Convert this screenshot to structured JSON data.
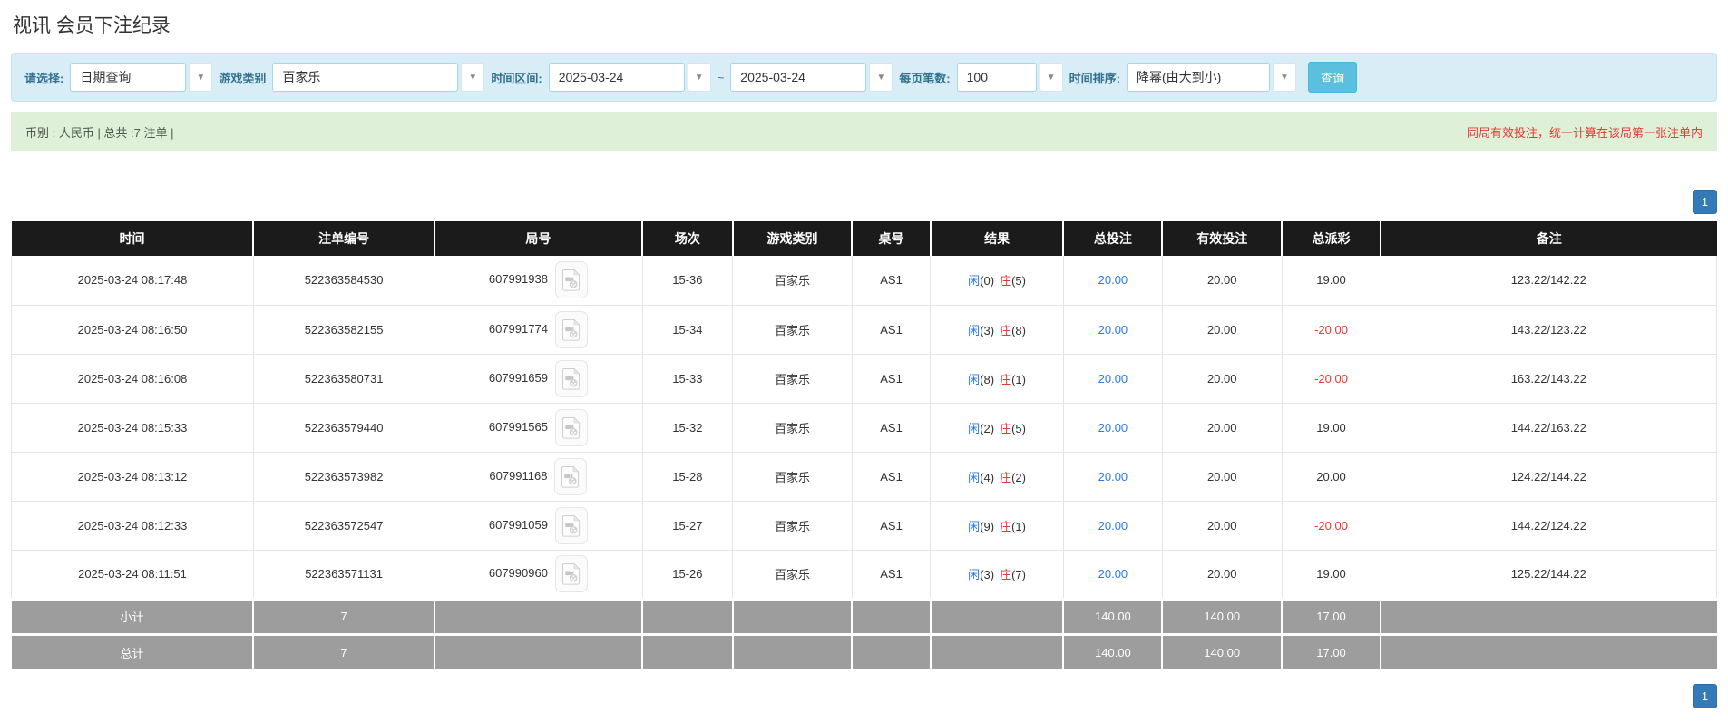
{
  "header": {
    "title": "视讯 会员下注纪录"
  },
  "icons": {
    "chevron_down": "▼"
  },
  "filters": {
    "select_label": "请选择:",
    "select_value": "日期查询",
    "game_label": "游戏类别",
    "game_value": "百家乐",
    "range_label": "时间区间:",
    "date_from": "2025-03-24",
    "tilde": "~",
    "date_to": "2025-03-24",
    "page_size_label": "每页笔数:",
    "page_size_value": "100",
    "sort_label": "时间排序:",
    "sort_value": "降幂(由大到小)",
    "query_button": "查询"
  },
  "summary": {
    "left": "币别 : 人民币 | 总共 :7 注单 |",
    "note": "同局有效投注，统一计算在该局第一张注单内"
  },
  "pagination": {
    "page": "1"
  },
  "table": {
    "headers": [
      "时间",
      "注单编号",
      "局号",
      "场次",
      "游戏类别",
      "桌号",
      "结果",
      "总投注",
      "有效投注",
      "总派彩",
      "备注"
    ],
    "rows": [
      {
        "time": "2025-03-24 08:17:48",
        "bet_no": "522363584530",
        "round_no": "607991938",
        "session": "15-36",
        "game": "百家乐",
        "table": "AS1",
        "result": {
          "player": "闲",
          "player_n": "(0)",
          "banker": "庄",
          "banker_n": "(5)"
        },
        "total_bet": "20.00",
        "valid_bet": "20.00",
        "payout": "19.00",
        "payout_class": "pos",
        "remark": "123.22/142.22"
      },
      {
        "time": "2025-03-24 08:16:50",
        "bet_no": "522363582155",
        "round_no": "607991774",
        "session": "15-34",
        "game": "百家乐",
        "table": "AS1",
        "result": {
          "player": "闲",
          "player_n": "(3)",
          "banker": "庄",
          "banker_n": "(8)"
        },
        "total_bet": "20.00",
        "valid_bet": "20.00",
        "payout": "-20.00",
        "payout_class": "neg",
        "remark": "143.22/123.22"
      },
      {
        "time": "2025-03-24 08:16:08",
        "bet_no": "522363580731",
        "round_no": "607991659",
        "session": "15-33",
        "game": "百家乐",
        "table": "AS1",
        "result": {
          "player": "闲",
          "player_n": "(8)",
          "banker": "庄",
          "banker_n": "(1)"
        },
        "total_bet": "20.00",
        "valid_bet": "20.00",
        "payout": "-20.00",
        "payout_class": "neg",
        "remark": "163.22/143.22"
      },
      {
        "time": "2025-03-24 08:15:33",
        "bet_no": "522363579440",
        "round_no": "607991565",
        "session": "15-32",
        "game": "百家乐",
        "table": "AS1",
        "result": {
          "player": "闲",
          "player_n": "(2)",
          "banker": "庄",
          "banker_n": "(5)"
        },
        "total_bet": "20.00",
        "valid_bet": "20.00",
        "payout": "19.00",
        "payout_class": "pos",
        "remark": "144.22/163.22"
      },
      {
        "time": "2025-03-24 08:13:12",
        "bet_no": "522363573982",
        "round_no": "607991168",
        "session": "15-28",
        "game": "百家乐",
        "table": "AS1",
        "result": {
          "player": "闲",
          "player_n": "(4)",
          "banker": "庄",
          "banker_n": "(2)"
        },
        "total_bet": "20.00",
        "valid_bet": "20.00",
        "payout": "20.00",
        "payout_class": "pos",
        "remark": "124.22/144.22"
      },
      {
        "time": "2025-03-24 08:12:33",
        "bet_no": "522363572547",
        "round_no": "607991059",
        "session": "15-27",
        "game": "百家乐",
        "table": "AS1",
        "result": {
          "player": "闲",
          "player_n": "(9)",
          "banker": "庄",
          "banker_n": "(1)"
        },
        "total_bet": "20.00",
        "valid_bet": "20.00",
        "payout": "-20.00",
        "payout_class": "neg",
        "remark": "144.22/124.22"
      },
      {
        "time": "2025-03-24 08:11:51",
        "bet_no": "522363571131",
        "round_no": "607990960",
        "session": "15-26",
        "game": "百家乐",
        "table": "AS1",
        "result": {
          "player": "闲",
          "player_n": "(3)",
          "banker": "庄",
          "banker_n": "(7)"
        },
        "total_bet": "20.00",
        "valid_bet": "20.00",
        "payout": "19.00",
        "payout_class": "pos",
        "remark": "125.22/144.22"
      }
    ],
    "footer": {
      "subtotal_label": "小计",
      "total_label": "总计",
      "count": "7",
      "total_bet": "140.00",
      "valid_bet": "140.00",
      "payout": "17.00"
    }
  },
  "colors": {
    "accent_blue": "#337ab7",
    "link_blue": "#2a7ae2",
    "negative_red": "#e53935",
    "note_red": "#e53935",
    "header_bg": "#1b1b1b",
    "footer_bg": "#9d9d9d",
    "filter_bg": "#d9edf7",
    "summary_bg": "#dff0d8",
    "query_btn_bg": "#5bc0de"
  }
}
